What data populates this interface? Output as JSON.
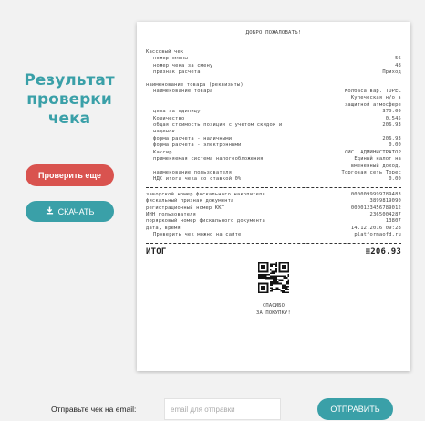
{
  "result": {
    "title": "Результат проверки чека"
  },
  "actions": {
    "check_again": "Проверить еще",
    "download": "СКАЧАТЬ"
  },
  "receipt": {
    "welcome": "ДОБРО ПОЖАЛОВАТЬ!",
    "header_rows": [
      {
        "k": "Кассовый чек",
        "v": "",
        "indent": false
      },
      {
        "k": "номер смены",
        "v": "56",
        "indent": true
      },
      {
        "k": "номер чека за смену",
        "v": "48",
        "indent": true
      },
      {
        "k": "признак расчета",
        "v": "Приход",
        "indent": true
      }
    ],
    "item_rows": [
      {
        "k": "наименование товара (реквизиты)",
        "v": "",
        "indent": false
      },
      {
        "k": "наименование товара",
        "v": "Колбаса вар. ТОРЕС",
        "indent": true
      },
      {
        "k": "",
        "v": "Купеческая н/о в",
        "indent": true
      },
      {
        "k": "",
        "v": "защитной атмосфере",
        "indent": true
      },
      {
        "k": "цена за единицу",
        "v": "379.00",
        "indent": true
      },
      {
        "k": "Количество",
        "v": "0.545",
        "indent": true
      },
      {
        "k": "общая стоимость позиции с учетом скидок и",
        "v": "206.93",
        "indent": true
      },
      {
        "k": "наценок",
        "v": "",
        "indent": true
      },
      {
        "k": "форма расчета - наличными",
        "v": "206.93",
        "indent": true
      },
      {
        "k": "форма расчета - электронными",
        "v": "0.00",
        "indent": true
      },
      {
        "k": "Кассир",
        "v": "СИС. АДМИНИСТРАТОР",
        "indent": true
      },
      {
        "k": "применяемая система налогообложения",
        "v": "Единый налог на",
        "indent": true
      },
      {
        "k": "",
        "v": "вмененный доход,",
        "indent": true
      },
      {
        "k": "наименование пользователя",
        "v": "Торговая сеть Торес",
        "indent": true
      },
      {
        "k": "НДС итога чека со ставкой 0%",
        "v": "0.00",
        "indent": true
      }
    ],
    "fiscal_rows": [
      {
        "k": "заводской номер фискального накопителя",
        "v": "0000099999789483",
        "indent": false
      },
      {
        "k": "фискальный признак документа",
        "v": "3899819090",
        "indent": false
      },
      {
        "k": "регистрационный номер ККТ",
        "v": "0000123456789012",
        "indent": false
      },
      {
        "k": "ИНН пользователя",
        "v": "2365004287",
        "indent": false
      },
      {
        "k": "порядковый номер фискального документа",
        "v": "13807",
        "indent": false
      },
      {
        "k": "дата, время",
        "v": "14.12.2016 09:28",
        "indent": false
      },
      {
        "k": "Проверить чек можно на сайте",
        "v": "platformaofd.ru",
        "indent": true
      }
    ],
    "total_label": "ИТОГ",
    "total_value": "≡206.93",
    "thanks_line1": "СПАСИБО",
    "thanks_line2": "ЗА ПОКУПКУ!"
  },
  "email": {
    "label": "Отправьте чек на email:",
    "placeholder": "email для отправки",
    "send": "ОТПРАВИТЬ"
  },
  "colors": {
    "accent": "#3aa0a8",
    "danger": "#d9534f",
    "background": "#f2f2f2"
  }
}
